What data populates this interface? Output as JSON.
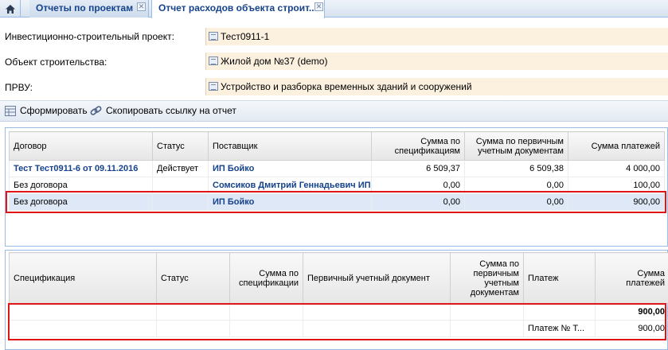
{
  "tabs": [
    {
      "label": "Отчеты по проектам",
      "close": "✕"
    },
    {
      "label": "Отчет расходов объекта строит...",
      "close": "✕"
    }
  ],
  "form": {
    "project_label": "Инвестиционно-строительный проект:",
    "project_value": "Тест0911-1",
    "object_label": "Объект строительства:",
    "object_value": "Жилой дом №37 (demo)",
    "prvu_label": "ПРВУ:",
    "prvu_value": "Устройство и разборка временных зданий и сооружений"
  },
  "toolbar": {
    "generate_label": "Сформировать",
    "copy_link_label": "Скопировать ссылку на отчет"
  },
  "contracts_grid": {
    "headers": [
      "Договор",
      "Статус",
      "Поставщик",
      "Сумма по спецификациям",
      "Сумма по первичным учетным документам",
      "Сумма платежей"
    ],
    "rows": [
      {
        "contract": "Тест Тест0911-6 от 09.11.2016",
        "status": "Действует",
        "supplier": "ИП Бойко",
        "spec_sum": "6 509,37",
        "doc_sum": "6 509,38",
        "payments": "4 000,00"
      },
      {
        "contract": "Без договора",
        "status": "",
        "supplier": "Сомсиков Дмитрий Геннадьевич ИП",
        "spec_sum": "0,00",
        "doc_sum": "0,00",
        "payments": "100,00"
      },
      {
        "contract": "Без договора",
        "status": "",
        "supplier": "ИП Бойко",
        "spec_sum": "0,00",
        "doc_sum": "0,00",
        "payments": "900,00"
      }
    ]
  },
  "details_grid": {
    "headers": [
      "Спецификация",
      "Статус",
      "Сумма по спецификации",
      "Первичный учетный документ",
      "Сумма по первичным учетным документам",
      "Платеж",
      "Сумма платежей"
    ],
    "rows": [
      {
        "spec": "",
        "status": "",
        "spec_sum": "",
        "doc": "",
        "doc_sum": "",
        "payment": "",
        "payments": "900,00"
      },
      {
        "spec": "",
        "status": "",
        "spec_sum": "",
        "doc": "",
        "doc_sum": "",
        "payment": "Платеж № Т...",
        "payments": "900,00"
      }
    ]
  },
  "colors": {
    "accent": "#15428b",
    "highlight": "#e01515",
    "field_bg": "#fcf1df",
    "selected_row": "#dfe8f6"
  },
  "icons": [
    "home-icon",
    "close-icon",
    "list-field-icon",
    "report-icon",
    "link-icon"
  ]
}
